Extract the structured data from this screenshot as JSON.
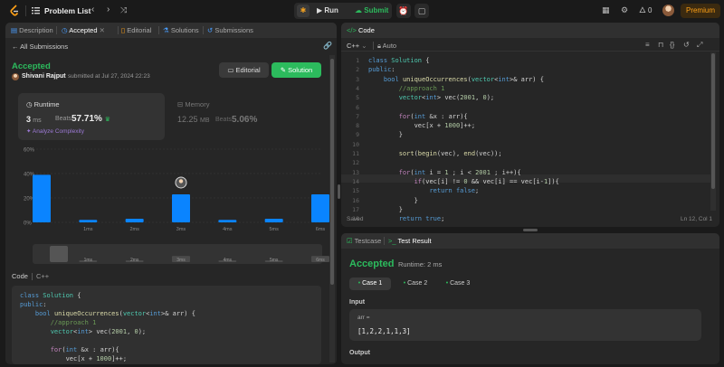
{
  "topbar": {
    "title": "Problem List",
    "run_label": "Run",
    "submit_label": "Submit",
    "streak_count": "0",
    "premium_label": "Premium"
  },
  "left": {
    "tabs": [
      {
        "label": "Description"
      },
      {
        "label": "Accepted"
      },
      {
        "label": "Editorial"
      },
      {
        "label": "Solutions"
      },
      {
        "label": "Submissions"
      }
    ],
    "back_label": "All Submissions",
    "status": "Accepted",
    "user": "Shivani Rajput",
    "submitted_meta": "submitted at Jul 27, 2024 22:23",
    "editorial_btn": "Editorial",
    "solution_btn": "Solution",
    "runtime": {
      "label": "Runtime",
      "value": "3",
      "unit": "ms",
      "beats_label": "Beats",
      "beats_pct": "57.71%",
      "analyze": "Analyze Complexity"
    },
    "memory": {
      "label": "Memory",
      "value": "12.25",
      "unit": "MB",
      "beats_label": "Beats",
      "beats_pct": "5.06%"
    },
    "code_label": "Code",
    "code_lang": "C++",
    "code_lines": [
      "class Solution {",
      "public:",
      "    bool uniqueOccurrences(vector<int>& arr) {",
      "        //approach 1",
      "        vector<int> vec(2001, 0);",
      "",
      "        for(int &x : arr){",
      "            vec[x + 1000]++;"
    ]
  },
  "chart_data": {
    "type": "bar",
    "categories": [
      "",
      "1ms",
      "2ms",
      "3ms",
      "4ms",
      "5ms",
      "6ms"
    ],
    "values": [
      39,
      2,
      3,
      23,
      2,
      3,
      23
    ],
    "ylim": [
      0,
      60
    ],
    "yticks": [
      "60%",
      "40%",
      "20%",
      "0%"
    ],
    "highlight_index": 3,
    "colors": {
      "bar": "#0a84ff",
      "grid": "#3a3a3a"
    }
  },
  "editor": {
    "tab_label": "Code",
    "lang": "C++",
    "auto_label": "Auto",
    "saved_label": "Saved",
    "cursor_pos": "Ln 12, Col 1",
    "lines": [
      "class Solution {",
      "public:",
      "    bool uniqueOccurrences(vector<int>& arr) {",
      "        //approach 1",
      "        vector<int> vec(2001, 0);",
      "",
      "        for(int &x : arr){",
      "            vec[x + 1000]++;",
      "        }",
      "",
      "        sort(begin(vec), end(vec));",
      "",
      "        for(int i = 1 ; i < 2001 ; i++){",
      "            if(vec[i] != 0 && vec[i] == vec[i-1]){",
      "                return false;",
      "            }",
      "        }",
      "        return true;"
    ]
  },
  "result": {
    "tab_testcase": "Testcase",
    "tab_result": "Test Result",
    "status": "Accepted",
    "runtime": "Runtime: 2 ms",
    "cases": [
      "Case 1",
      "Case 2",
      "Case 3"
    ],
    "input_label": "Input",
    "input_name": "arr =",
    "input_value": "[1,2,2,1,1,3]",
    "output_label": "Output"
  }
}
